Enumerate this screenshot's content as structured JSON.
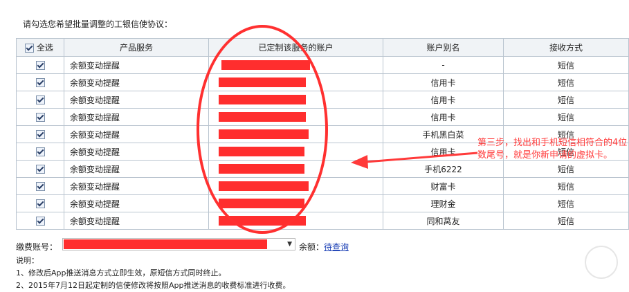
{
  "heading": "请勾选您希望批量调整的工银信使协议：",
  "table": {
    "headers": {
      "select_all": "全选",
      "product": "产品服务",
      "account": "已定制该服务的账户",
      "alias": "账户别名",
      "receive": "接收方式"
    },
    "rows": [
      {
        "product": "余额变动提醒",
        "alias": "-",
        "receive": "短信"
      },
      {
        "product": "余额变动提醒",
        "alias": "信用卡",
        "receive": "短信"
      },
      {
        "product": "余额变动提醒",
        "alias": "信用卡",
        "receive": "短信"
      },
      {
        "product": "余额变动提醒",
        "alias": "信用卡",
        "receive": "短信"
      },
      {
        "product": "余额变动提醒",
        "alias": "手机黑白菜",
        "receive": "短信"
      },
      {
        "product": "余额变动提醒",
        "alias": "信用卡",
        "receive": "短信"
      },
      {
        "product": "余额变动提醒",
        "alias": "手机6222",
        "receive": "短信"
      },
      {
        "product": "余额变动提醒",
        "alias": "财富卡",
        "receive": "短信"
      },
      {
        "product": "余额变动提醒",
        "alias": "理财金",
        "receive": "短信"
      },
      {
        "product": "余额变动提醒",
        "alias": "同和莴友",
        "receive": "短信"
      }
    ]
  },
  "annotation": "第三步，找出和手机短信相符合的4位数尾号，就是你新申请的虚拟卡。",
  "payment": {
    "label": "缴费账号：",
    "balance_label": "余额：",
    "balance_link": "待查询"
  },
  "notes": {
    "title": "说明：",
    "items": [
      "1、修改后App推送消息方式立即生效，原短信方式同时终止。",
      "2、2015年7月12日起定制的信使修改将按照App推送消息的收费标准进行收费。"
    ]
  },
  "colors": {
    "redaction": "#ff2e2e",
    "annotation": "#ff3a3a",
    "header_bg": "#f0f3f6",
    "link": "#1a3fb5"
  },
  "icons": {
    "checkbox": "checkbox-checked-icon",
    "arrow": "left-arrow-icon",
    "dropdown": "chevron-down-icon"
  }
}
